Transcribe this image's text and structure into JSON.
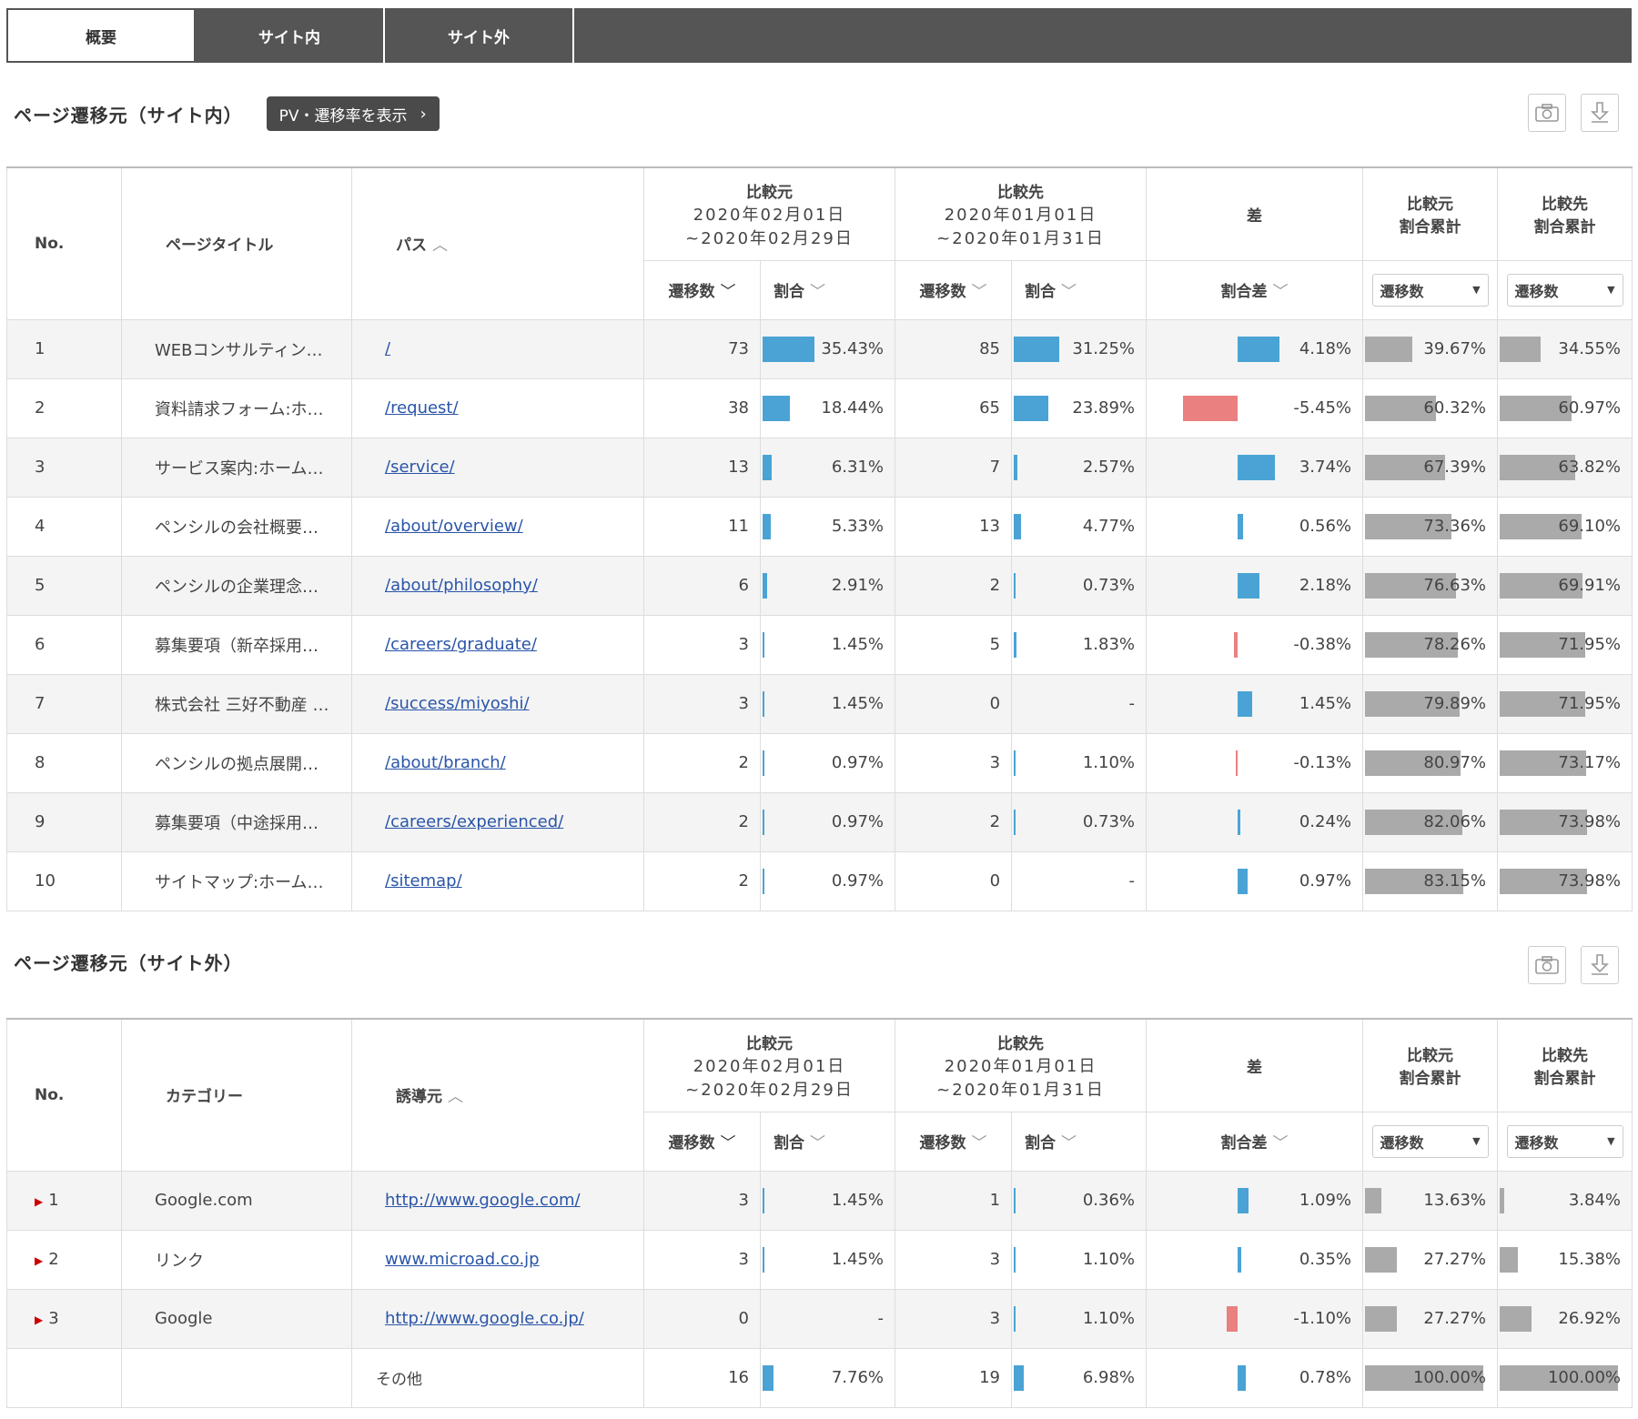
{
  "tabs": [
    {
      "label": "概要",
      "active": true
    },
    {
      "label": "サイト内",
      "active": false
    },
    {
      "label": "サイト外",
      "active": false
    }
  ],
  "section1": {
    "title": "ページ遷移元（サイト内）",
    "pv_button": "PV・遷移率を表示",
    "headers": {
      "no": "No.",
      "title": "ページタイトル",
      "path": "パス",
      "compare_from": "比較元",
      "from_date1": "2020年02月01日",
      "from_date2": "~2020年02月29日",
      "compare_to": "比較先",
      "to_date1": "2020年01月01日",
      "to_date2": "~2020年01月31日",
      "diff": "差",
      "cum_from1": "比較元",
      "cum_from2": "割合累計",
      "cum_to1": "比較先",
      "cum_to2": "割合累計",
      "transitions": "遷移数",
      "ratio": "割合",
      "ratio_diff": "割合差",
      "select_value": "遷移数"
    },
    "rows": [
      {
        "no": "1",
        "title": "WEBコンサルティン…",
        "path": "/",
        "a_count": "73",
        "a_ratio": "35.43%",
        "a_pct": 35.43,
        "b_count": "85",
        "b_ratio": "31.25%",
        "b_pct": 31.25,
        "diff": "4.18%",
        "diff_pct": 4.18,
        "cum_a": "39.67%",
        "cum_a_pct": 39.67,
        "cum_b": "34.55%",
        "cum_b_pct": 34.55
      },
      {
        "no": "2",
        "title": "資料請求フォーム:ホ…",
        "path": "/request/",
        "a_count": "38",
        "a_ratio": "18.44%",
        "a_pct": 18.44,
        "b_count": "65",
        "b_ratio": "23.89%",
        "b_pct": 23.89,
        "diff": "-5.45%",
        "diff_pct": -5.45,
        "cum_a": "60.32%",
        "cum_a_pct": 60.32,
        "cum_b": "60.97%",
        "cum_b_pct": 60.97
      },
      {
        "no": "3",
        "title": "サービス案内:ホーム…",
        "path": "/service/",
        "a_count": "13",
        "a_ratio": "6.31%",
        "a_pct": 6.31,
        "b_count": "7",
        "b_ratio": "2.57%",
        "b_pct": 2.57,
        "diff": "3.74%",
        "diff_pct": 3.74,
        "cum_a": "67.39%",
        "cum_a_pct": 67.39,
        "cum_b": "63.82%",
        "cum_b_pct": 63.82
      },
      {
        "no": "4",
        "title": "ペンシルの会社概要…",
        "path": "/about/overview/",
        "a_count": "11",
        "a_ratio": "5.33%",
        "a_pct": 5.33,
        "b_count": "13",
        "b_ratio": "4.77%",
        "b_pct": 4.77,
        "diff": "0.56%",
        "diff_pct": 0.56,
        "cum_a": "73.36%",
        "cum_a_pct": 73.36,
        "cum_b": "69.10%",
        "cum_b_pct": 69.1
      },
      {
        "no": "5",
        "title": "ペンシルの企業理念…",
        "path": "/about/philosophy/",
        "a_count": "6",
        "a_ratio": "2.91%",
        "a_pct": 2.91,
        "b_count": "2",
        "b_ratio": "0.73%",
        "b_pct": 0.73,
        "diff": "2.18%",
        "diff_pct": 2.18,
        "cum_a": "76.63%",
        "cum_a_pct": 76.63,
        "cum_b": "69.91%",
        "cum_b_pct": 69.91
      },
      {
        "no": "6",
        "title": "募集要項（新卒採用…",
        "path": "/careers/graduate/",
        "a_count": "3",
        "a_ratio": "1.45%",
        "a_pct": 1.45,
        "b_count": "5",
        "b_ratio": "1.83%",
        "b_pct": 1.83,
        "diff": "-0.38%",
        "diff_pct": -0.38,
        "cum_a": "78.26%",
        "cum_a_pct": 78.26,
        "cum_b": "71.95%",
        "cum_b_pct": 71.95
      },
      {
        "no": "7",
        "title": "株式会社 三好不動産 …",
        "path": "/success/miyoshi/",
        "a_count": "3",
        "a_ratio": "1.45%",
        "a_pct": 1.45,
        "b_count": "0",
        "b_ratio": "-",
        "b_pct": 0,
        "diff": "1.45%",
        "diff_pct": 1.45,
        "cum_a": "79.89%",
        "cum_a_pct": 79.89,
        "cum_b": "71.95%",
        "cum_b_pct": 71.95
      },
      {
        "no": "8",
        "title": "ペンシルの拠点展開…",
        "path": "/about/branch/",
        "a_count": "2",
        "a_ratio": "0.97%",
        "a_pct": 0.97,
        "b_count": "3",
        "b_ratio": "1.10%",
        "b_pct": 1.1,
        "diff": "-0.13%",
        "diff_pct": -0.13,
        "cum_a": "80.97%",
        "cum_a_pct": 80.97,
        "cum_b": "73.17%",
        "cum_b_pct": 73.17
      },
      {
        "no": "9",
        "title": "募集要項（中途採用…",
        "path": "/careers/experienced/",
        "a_count": "2",
        "a_ratio": "0.97%",
        "a_pct": 0.97,
        "b_count": "2",
        "b_ratio": "0.73%",
        "b_pct": 0.73,
        "diff": "0.24%",
        "diff_pct": 0.24,
        "cum_a": "82.06%",
        "cum_a_pct": 82.06,
        "cum_b": "73.98%",
        "cum_b_pct": 73.98
      },
      {
        "no": "10",
        "title": "サイトマップ:ホーム…",
        "path": "/sitemap/",
        "a_count": "2",
        "a_ratio": "0.97%",
        "a_pct": 0.97,
        "b_count": "0",
        "b_ratio": "-",
        "b_pct": 0,
        "diff": "0.97%",
        "diff_pct": 0.97,
        "cum_a": "83.15%",
        "cum_a_pct": 83.15,
        "cum_b": "73.98%",
        "cum_b_pct": 73.98
      }
    ]
  },
  "section2": {
    "title": "ページ遷移元（サイト外）",
    "headers": {
      "no": "No.",
      "title": "カテゴリー",
      "path": "誘導元",
      "compare_from": "比較元",
      "from_date1": "2020年02月01日",
      "from_date2": "~2020年02月29日",
      "compare_to": "比較先",
      "to_date1": "2020年01月01日",
      "to_date2": "~2020年01月31日",
      "diff": "差",
      "cum_from1": "比較元",
      "cum_from2": "割合累計",
      "cum_to1": "比較先",
      "cum_to2": "割合累計",
      "transitions": "遷移数",
      "ratio": "割合",
      "ratio_diff": "割合差",
      "select_value": "遷移数"
    },
    "rows": [
      {
        "no": "1",
        "title": "Google.com",
        "path": "http://www.google.com/",
        "a_count": "3",
        "a_ratio": "1.45%",
        "a_pct": 1.45,
        "b_count": "1",
        "b_ratio": "0.36%",
        "b_pct": 0.36,
        "diff": "1.09%",
        "diff_pct": 1.09,
        "cum_a": "13.63%",
        "cum_a_pct": 13.63,
        "cum_b": "3.84%",
        "cum_b_pct": 3.84
      },
      {
        "no": "2",
        "title": "リンク",
        "path": "www.microad.co.jp",
        "a_count": "3",
        "a_ratio": "1.45%",
        "a_pct": 1.45,
        "b_count": "3",
        "b_ratio": "1.10%",
        "b_pct": 1.1,
        "diff": "0.35%",
        "diff_pct": 0.35,
        "cum_a": "27.27%",
        "cum_a_pct": 27.27,
        "cum_b": "15.38%",
        "cum_b_pct": 15.38
      },
      {
        "no": "3",
        "title": "Google",
        "path": "http://www.google.co.jp/",
        "a_count": "0",
        "a_ratio": "-",
        "a_pct": 0,
        "b_count": "3",
        "b_ratio": "1.10%",
        "b_pct": 1.1,
        "diff": "-1.10%",
        "diff_pct": -1.1,
        "cum_a": "27.27%",
        "cum_a_pct": 27.27,
        "cum_b": "26.92%",
        "cum_b_pct": 26.92
      }
    ],
    "other": {
      "label": "その他",
      "a_count": "16",
      "a_ratio": "7.76%",
      "a_pct": 7.76,
      "b_count": "19",
      "b_ratio": "6.98%",
      "b_pct": 6.98,
      "diff": "0.78%",
      "diff_pct": 0.78,
      "cum_a": "100.00%",
      "cum_a_pct": 100,
      "cum_b": "100.00%",
      "cum_b_pct": 100
    }
  },
  "icons": {
    "camera": "camera-icon",
    "download": "download-icon",
    "sort_up": "sort-up-icon",
    "sort_down": "sort-down-icon",
    "expand": "expand-triangle-icon"
  },
  "colors": {
    "tab_bg": "#555555",
    "bar_blue": "#4aa3d4",
    "bar_red": "#ea8080",
    "bar_gray": "#aaaaaa",
    "link": "#2a55a8"
  }
}
